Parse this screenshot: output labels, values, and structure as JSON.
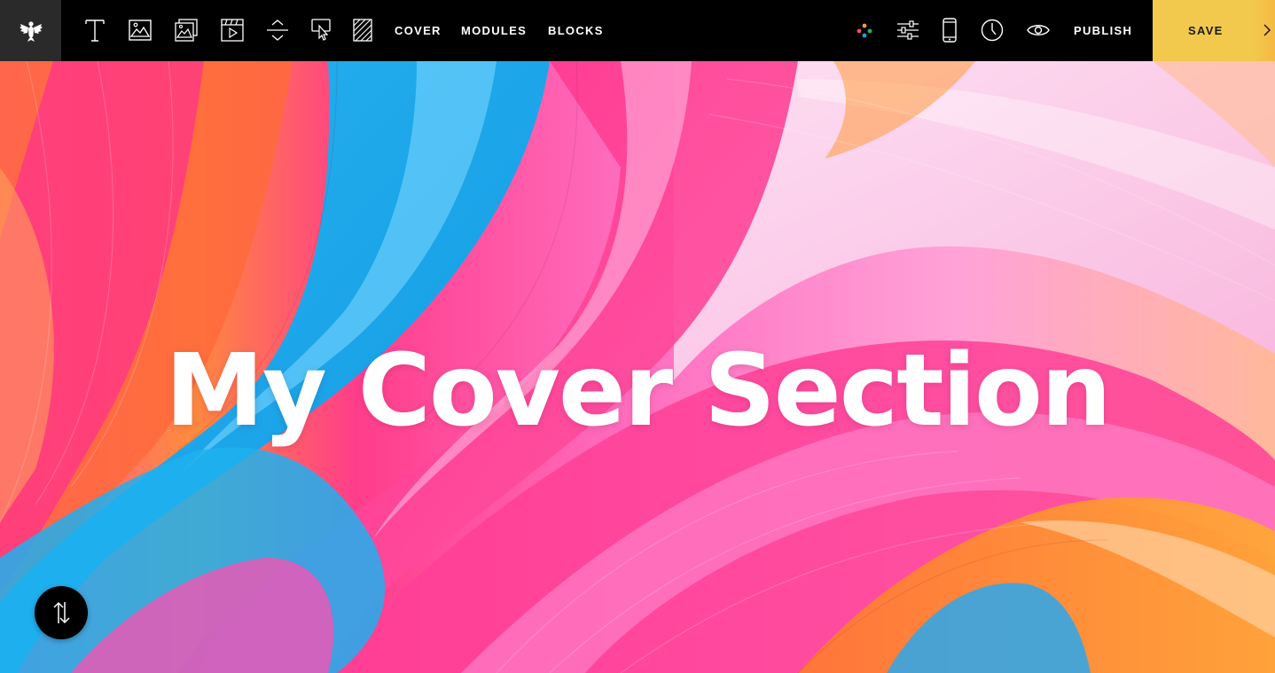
{
  "toolbar": {
    "logo_icon": "eagle-logo-icon",
    "tools": [
      {
        "name": "text-tool",
        "icon": "text-icon"
      },
      {
        "name": "image-tool",
        "icon": "image-icon"
      },
      {
        "name": "gallery-tool",
        "icon": "gallery-icon"
      },
      {
        "name": "video-tool",
        "icon": "video-icon"
      },
      {
        "name": "spacer-tool",
        "icon": "spacer-icon"
      },
      {
        "name": "button-tool",
        "icon": "click-icon"
      },
      {
        "name": "pattern-tool",
        "icon": "pattern-icon"
      }
    ],
    "nav": {
      "cover": "COVER",
      "modules": "MODULES",
      "blocks": "BLOCKS"
    },
    "right_icons": [
      "colors-icon",
      "sliders-icon",
      "mobile-icon",
      "clock-icon",
      "eye-icon"
    ],
    "publish_label": "PUBLISH",
    "save_label": "SAVE"
  },
  "cover": {
    "title": "My Cover Section",
    "reorder_icon": "reorder-arrows-icon"
  },
  "colors": {
    "toolbar_bg": "#000000",
    "logo_bg": "#2a2a2a",
    "save_bg": "#f2c94c",
    "title": "#ffffff"
  }
}
